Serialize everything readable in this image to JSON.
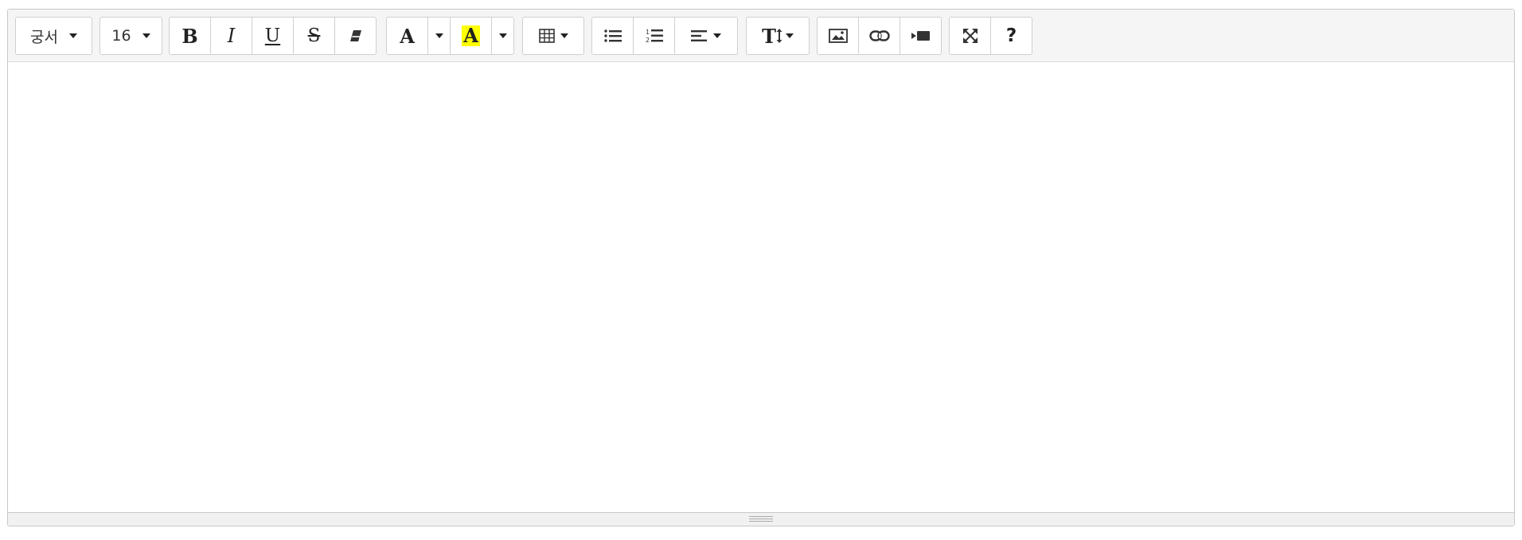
{
  "toolbar": {
    "font_family": {
      "label": "궁서"
    },
    "font_size": {
      "label": "16"
    },
    "style": {
      "bold": {
        "glyph": "B"
      },
      "italic": {
        "glyph": "I"
      },
      "underline": {
        "glyph": "U"
      },
      "strikethrough": {
        "glyph": "S"
      },
      "clear_format_icon": "eraser-icon"
    },
    "color": {
      "font_color": {
        "glyph": "A"
      },
      "highlight_color": {
        "glyph": "A",
        "swatch": "#ffff00"
      }
    },
    "table_icon": "table-icon",
    "list": {
      "unordered_icon": "bulleted-list-icon",
      "ordered_icon": "numbered-list-icon",
      "align_icon": "align-left-icon"
    },
    "line_height": {
      "glyph": "T",
      "icon": "line-height-icon"
    },
    "insert": {
      "picture_icon": "picture-icon",
      "link_icon": "link-icon",
      "video_icon": "video-icon"
    },
    "view": {
      "fullscreen_icon": "fullscreen-icon",
      "help": {
        "glyph": "?"
      }
    }
  },
  "colors": {
    "toolbar_bg": "#f5f5f5",
    "border": "#cfcfcf",
    "highlight": "#ffff00"
  }
}
